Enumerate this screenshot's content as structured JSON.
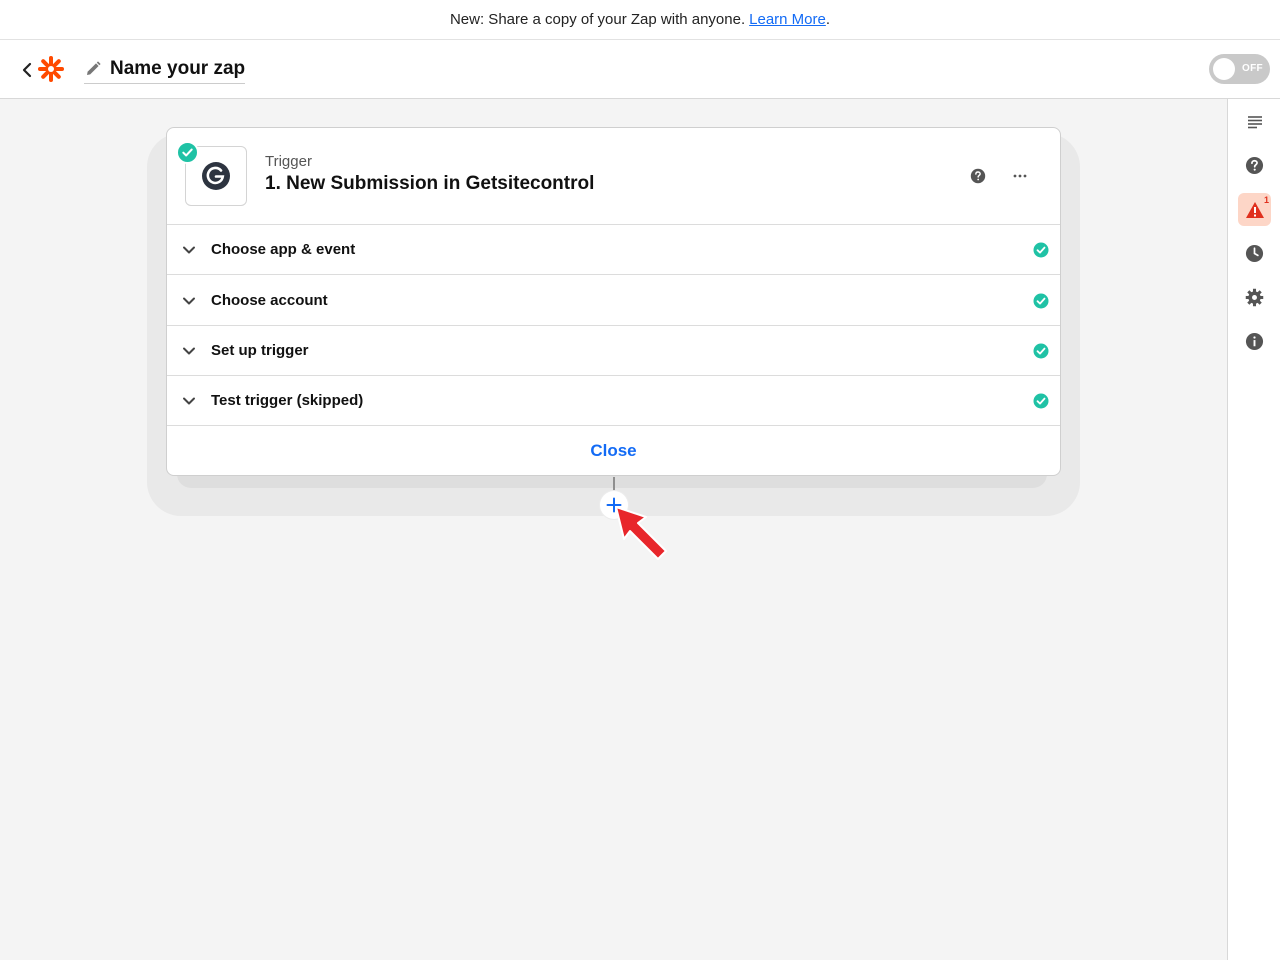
{
  "banner": {
    "text": "New: Share a copy of your Zap with anyone.",
    "link": "Learn More",
    "suffix": "."
  },
  "header": {
    "zap_name": "Name your zap",
    "toggle_label": "OFF",
    "toggle_state": "off"
  },
  "colors": {
    "brand_orange": "#ff4a00",
    "link_blue": "#136bf5",
    "success_green": "#1fc2a5",
    "alert_red": "#e0301e"
  },
  "rail": {
    "items": [
      {
        "icon": "outline-icon"
      },
      {
        "icon": "help-icon"
      },
      {
        "icon": "warning-icon",
        "badge": "1"
      },
      {
        "icon": "history-icon"
      },
      {
        "icon": "settings-icon"
      },
      {
        "icon": "info-icon"
      }
    ]
  },
  "step": {
    "type": "Trigger",
    "title": "1. New Submission in Getsitecontrol",
    "app_icon": "getsitecontrol-logo",
    "status": "complete",
    "sections": [
      {
        "label": "Choose app & event",
        "status": "complete"
      },
      {
        "label": "Choose account",
        "status": "complete"
      },
      {
        "label": "Set up trigger",
        "status": "complete"
      },
      {
        "label": "Test trigger (skipped)",
        "status": "complete"
      }
    ],
    "close_label": "Close"
  }
}
